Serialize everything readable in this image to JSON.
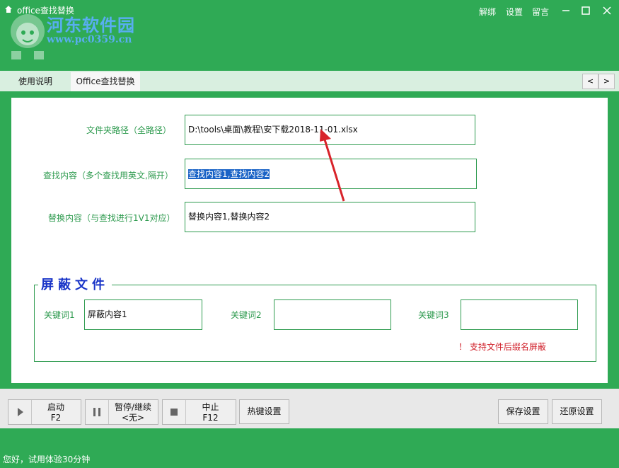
{
  "window": {
    "title": "office查找替换",
    "links": [
      "解绑",
      "设置",
      "留言"
    ]
  },
  "watermark": {
    "name": "河东软件园",
    "url": "www.pc0359.cn"
  },
  "tabs": [
    {
      "label": "使用说明"
    },
    {
      "label": "Office查找替换"
    }
  ],
  "nav": {
    "prev": "<",
    "next": ">"
  },
  "form": {
    "folder_label": "文件夹路径（全路径）",
    "folder_value": "D:\\tools\\桌面\\教程\\安下载2018-11-01.xlsx",
    "find_label": "查找内容（多个查找用英文,隔开）",
    "find_value": "查找内容1,查找内容2",
    "replace_label": "替换内容（与查找进行1V1对应）",
    "replace_value": "替换内容1,替换内容2"
  },
  "block": {
    "legend": "屏蔽文件",
    "keyword1_label": "关键词1",
    "keyword1_value": "屏蔽内容1",
    "keyword2_label": "关键词2",
    "keyword2_value": "",
    "keyword3_label": "关键词3",
    "keyword3_value": "",
    "note": "！ 支持文件后缀名屏蔽"
  },
  "controls": {
    "start": {
      "label": "启动",
      "key": "F2"
    },
    "pause": {
      "label": "暂停/继续",
      "key": "<无>"
    },
    "stop": {
      "label": "中止",
      "key": "F12"
    },
    "hotkey": "热键设置",
    "save": "保存设置",
    "restore": "还原设置"
  },
  "status": "您好，试用体验30分钟",
  "colors": {
    "brand": "#2faa55",
    "field_border": "#2e9b4f",
    "label": "#2d9a4e",
    "warn": "#d0202a",
    "legend": "#1a35c8"
  }
}
